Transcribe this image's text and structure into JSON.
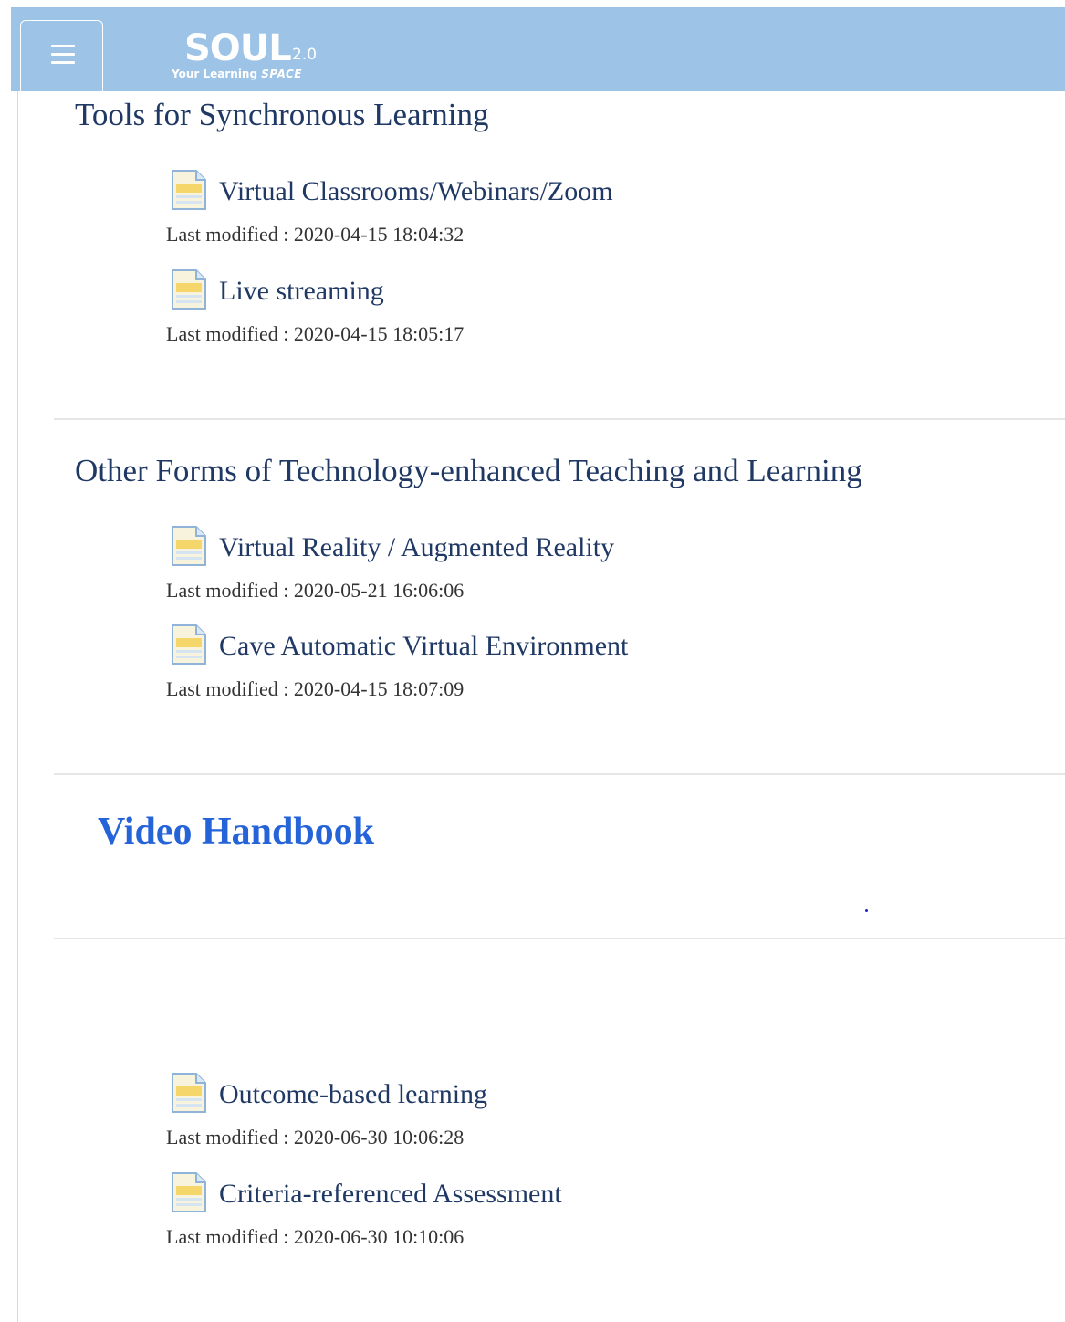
{
  "header": {
    "logo_main": "SOUL",
    "logo_version": "2.0",
    "logo_tagline": "Your Learning",
    "logo_tagline_space": "SPACE",
    "menu_icon": "hamburger-icon",
    "bar_color": "#9dc3e6"
  },
  "sections": [
    {
      "title": "Tools for Synchronous Learning",
      "items": [
        {
          "label": "Virtual Classrooms/Webinars/Zoom",
          "meta": "Last modified : 2020-04-15 18:04:32",
          "icon": "document-icon"
        },
        {
          "label": "Live streaming",
          "meta": "Last modified : 2020-04-15 18:05:17",
          "icon": "document-icon"
        }
      ]
    },
    {
      "title": "Other Forms of Technology-enhanced Teaching and Learning",
      "items": [
        {
          "label": "Virtual Reality / Augmented Reality",
          "meta": "Last modified : 2020-05-21 16:06:06",
          "icon": "document-icon"
        },
        {
          "label": "Cave Automatic Virtual Environment",
          "meta": "Last modified : 2020-04-15 18:07:09",
          "icon": "document-icon"
        }
      ]
    },
    {
      "title": "Video Handbook",
      "title_color": "#2563d9",
      "items": []
    },
    {
      "title": "",
      "items": [
        {
          "label": "Outcome-based learning",
          "meta": "Last modified : 2020-06-30 10:06:28",
          "icon": "document-icon"
        },
        {
          "label": "Criteria-referenced Assessment",
          "meta": "Last modified : 2020-06-30 10:10:06",
          "icon": "document-icon"
        }
      ]
    }
  ]
}
